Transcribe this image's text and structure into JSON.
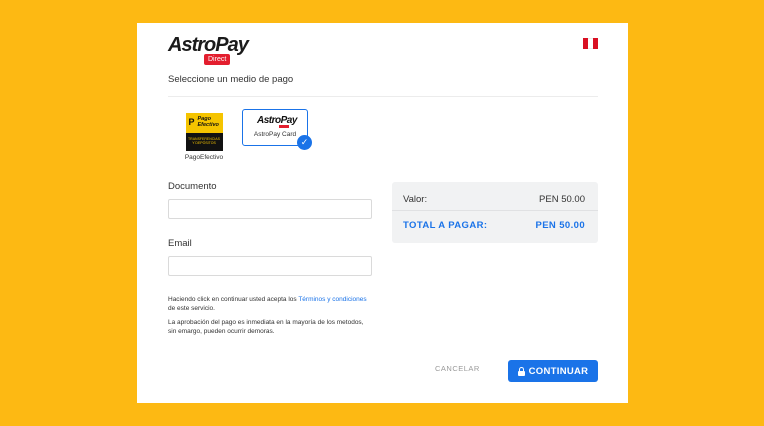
{
  "brand": {
    "name": "AstroPay",
    "sub": "Direct"
  },
  "colors": {
    "background": "#fdb913",
    "accent": "#1a73e8",
    "brand_red": "#e31e2e"
  },
  "flag": {
    "icon": "peru-flag-icon"
  },
  "section_title": "Seleccione un medio de pago",
  "methods": [
    {
      "name": "PagoEfectivo",
      "logo_text": "Pago Efectivo",
      "logo_sub": "TRANSFERENCIAS Y DEPÓSITOS",
      "selected": false
    },
    {
      "name": "AstroPay Card",
      "logo_text": "AstroPay",
      "selected": true
    }
  ],
  "form": {
    "documento_label": "Documento",
    "documento_value": "",
    "email_label": "Email",
    "email_value": ""
  },
  "summary": {
    "valor_label": "Valor:",
    "valor_amount": "PEN 50.00",
    "total_label": "TOTAL A PAGAR:",
    "total_amount": "PEN 50.00"
  },
  "terms": {
    "p1_pre": "Haciendo click en continuar usted acepta los ",
    "p1_link": "Términos y condiciones",
    "p1_post": " de este servicio.",
    "p2": "La aprobación del pago es inmediata en la mayoría de los metodos, sin emargo, pueden ocurrir demoras."
  },
  "buttons": {
    "cancel": "CANCELAR",
    "continue": "CONTINUAR"
  }
}
